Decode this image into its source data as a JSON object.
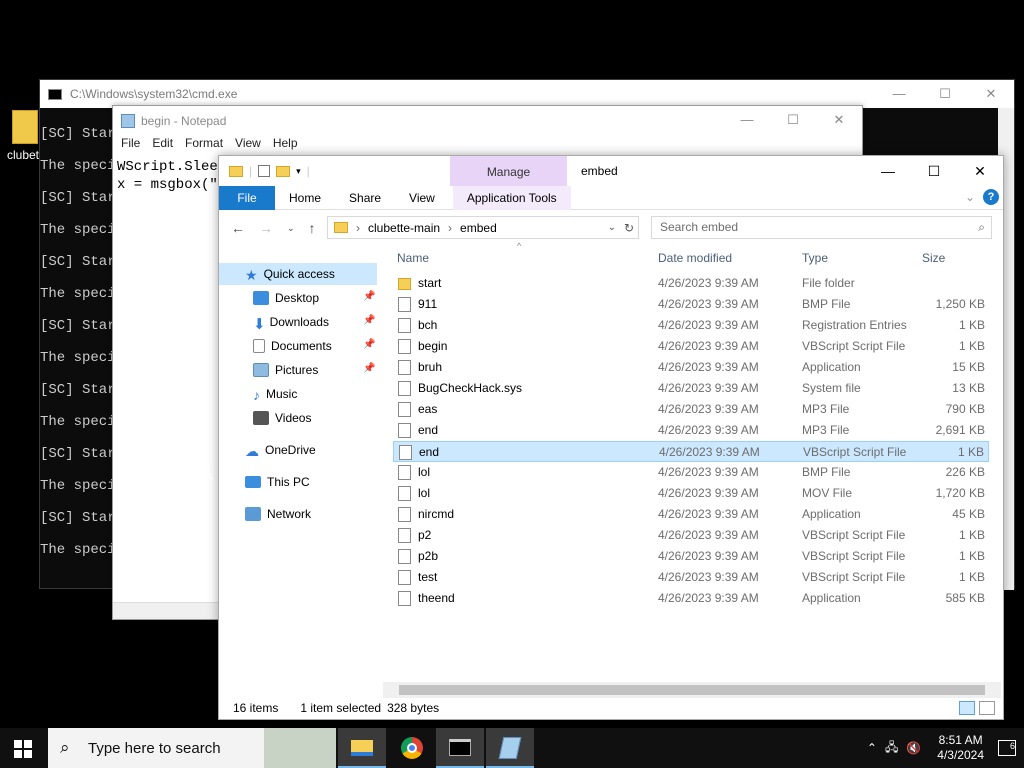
{
  "desktop": {
    "icon_label": "clubet"
  },
  "cmd": {
    "title": "C:\\Windows\\system32\\cmd.exe",
    "lines": [
      "[SC] Star",
      "The speci",
      "[SC] Star",
      "The speci",
      "[SC] Star",
      "The speci",
      "[SC] Star",
      "The speci",
      "[SC] Star",
      "The speci",
      "[SC] Star",
      "The speci",
      "[SC] Star",
      "The speci"
    ]
  },
  "notepad": {
    "title": "begin - Notepad",
    "menu": [
      "File",
      "Edit",
      "Format",
      "View",
      "Help"
    ],
    "text": [
      "WScript.Sleep",
      "x = msgbox(\"A"
    ]
  },
  "explorer": {
    "manage": "Manage",
    "window_name": "embed",
    "ribbon": {
      "file": "File",
      "home": "Home",
      "share": "Share",
      "view": "View",
      "app_tools": "Application Tools",
      "help": "?"
    },
    "path": [
      "clubette-main",
      "embed"
    ],
    "search_placeholder": "Search embed",
    "sidebar": {
      "quick_access": "Quick access",
      "desktop": "Desktop",
      "downloads": "Downloads",
      "documents": "Documents",
      "pictures": "Pictures",
      "music": "Music",
      "videos": "Videos",
      "onedrive": "OneDrive",
      "this_pc": "This PC",
      "network": "Network"
    },
    "columns": {
      "name": "Name",
      "date": "Date modified",
      "type": "Type",
      "size": "Size"
    },
    "files": [
      {
        "name": "start",
        "date": "4/26/2023 9:39 AM",
        "type": "File folder",
        "size": "",
        "icon": "folder"
      },
      {
        "name": "911",
        "date": "4/26/2023 9:39 AM",
        "type": "BMP File",
        "size": "1,250 KB",
        "icon": "file"
      },
      {
        "name": "bch",
        "date": "4/26/2023 9:39 AM",
        "type": "Registration Entries",
        "size": "1 KB",
        "icon": "file"
      },
      {
        "name": "begin",
        "date": "4/26/2023 9:39 AM",
        "type": "VBScript Script File",
        "size": "1 KB",
        "icon": "file"
      },
      {
        "name": "bruh",
        "date": "4/26/2023 9:39 AM",
        "type": "Application",
        "size": "15 KB",
        "icon": "file"
      },
      {
        "name": "BugCheckHack.sys",
        "date": "4/26/2023 9:39 AM",
        "type": "System file",
        "size": "13 KB",
        "icon": "file"
      },
      {
        "name": "eas",
        "date": "4/26/2023 9:39 AM",
        "type": "MP3 File",
        "size": "790 KB",
        "icon": "file"
      },
      {
        "name": "end",
        "date": "4/26/2023 9:39 AM",
        "type": "MP3 File",
        "size": "2,691 KB",
        "icon": "file"
      },
      {
        "name": "end",
        "date": "4/26/2023 9:39 AM",
        "type": "VBScript Script File",
        "size": "1 KB",
        "icon": "file"
      },
      {
        "name": "lol",
        "date": "4/26/2023 9:39 AM",
        "type": "BMP File",
        "size": "226 KB",
        "icon": "file"
      },
      {
        "name": "lol",
        "date": "4/26/2023 9:39 AM",
        "type": "MOV File",
        "size": "1,720 KB",
        "icon": "file"
      },
      {
        "name": "nircmd",
        "date": "4/26/2023 9:39 AM",
        "type": "Application",
        "size": "45 KB",
        "icon": "file"
      },
      {
        "name": "p2",
        "date": "4/26/2023 9:39 AM",
        "type": "VBScript Script File",
        "size": "1 KB",
        "icon": "file"
      },
      {
        "name": "p2b",
        "date": "4/26/2023 9:39 AM",
        "type": "VBScript Script File",
        "size": "1 KB",
        "icon": "file"
      },
      {
        "name": "test",
        "date": "4/26/2023 9:39 AM",
        "type": "VBScript Script File",
        "size": "1 KB",
        "icon": "file"
      },
      {
        "name": "theend",
        "date": "4/26/2023 9:39 AM",
        "type": "Application",
        "size": "585 KB",
        "icon": "file"
      }
    ],
    "selected_index": 8,
    "status": {
      "count": "16 items",
      "selected": "1 item selected",
      "bytes": "328 bytes"
    }
  },
  "taskbar": {
    "search_placeholder": "Type here to search",
    "time": "8:51 AM",
    "date": "4/3/2024",
    "notifications": "6"
  }
}
